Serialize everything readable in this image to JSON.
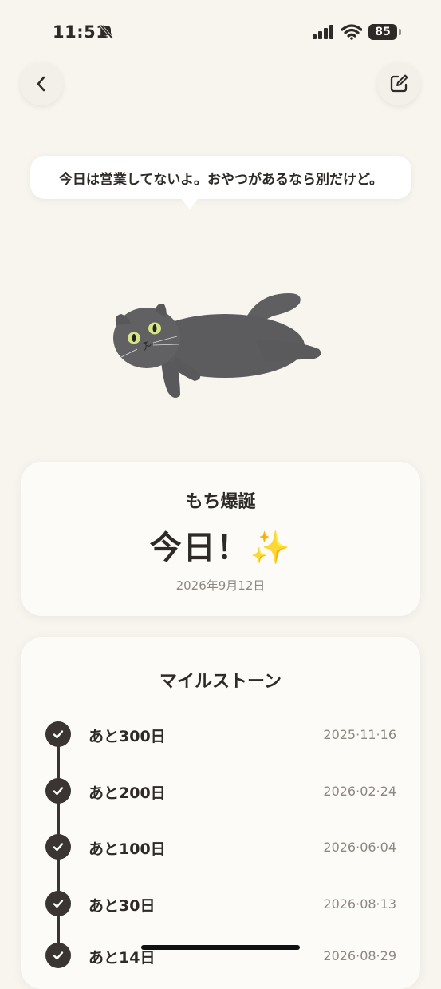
{
  "status": {
    "time": "11:51",
    "battery": "85",
    "icons": [
      "bell-slash-icon",
      "signal-icon",
      "wifi-icon",
      "battery-icon"
    ]
  },
  "nav": {
    "back_icon": "chevron-left-icon",
    "edit_icon": "edit-icon"
  },
  "bubble": {
    "text": "今日は営業してないよ。おやつがあるなら別だけど。"
  },
  "birthday": {
    "label": "もち爆誕",
    "main": "今日！✨",
    "date": "2026年9月12日"
  },
  "milestones": {
    "title": "マイルストーン",
    "items": [
      {
        "label": "あと300日",
        "date": "2025·11·16"
      },
      {
        "label": "あと200日",
        "date": "2026·02·24"
      },
      {
        "label": "あと100日",
        "date": "2026·06·04"
      },
      {
        "label": "あと30日",
        "date": "2026·08·13"
      },
      {
        "label": "あと14日",
        "date": "2026·08·29"
      }
    ]
  },
  "colors": {
    "background": "#f8f5ef",
    "text": "#2e2a27",
    "muted": "#8e8883",
    "check": "#3a3532"
  }
}
